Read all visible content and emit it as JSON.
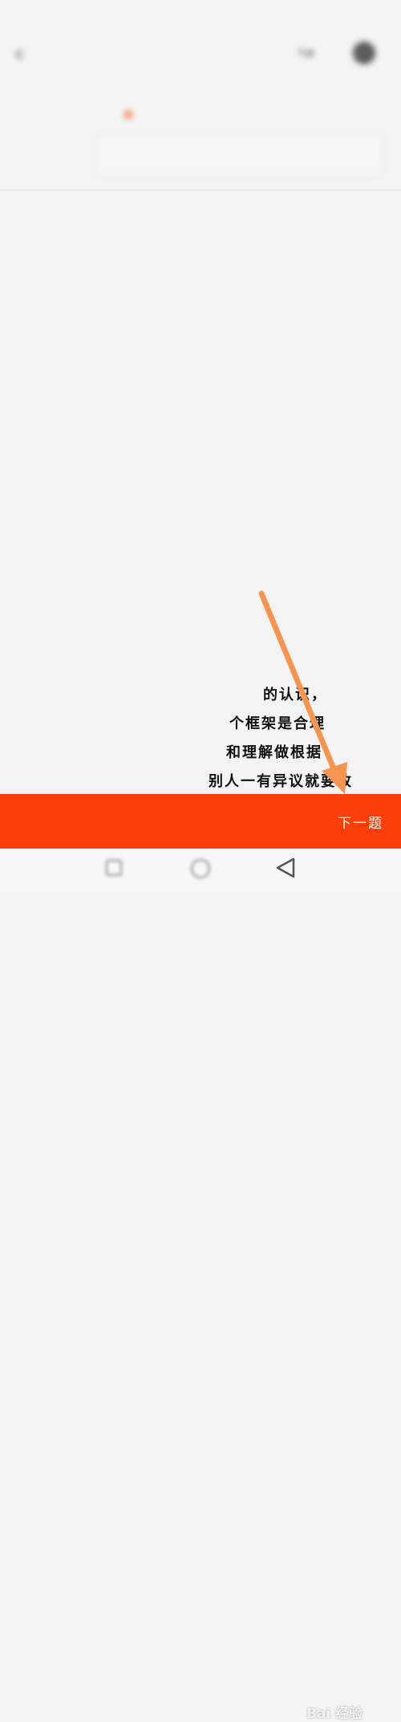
{
  "status_bar": {
    "time": "",
    "indicators": ""
  },
  "header": {
    "title": ""
  },
  "score_area": {
    "score_label": "",
    "score_value": "",
    "input_label": "",
    "input_value": ""
  },
  "article": {
    "section_heading": "",
    "paragraphs": [
      "",
      "",
      ""
    ],
    "visible_fragments": [
      "的认识，",
      "个框架是合理",
      "和理解做根据",
      "别人一有异议就要改"
    ]
  },
  "action_bar": {
    "page_counter": "",
    "next_label": "下一题"
  },
  "watermark": {
    "text": "Bai 经验"
  },
  "colors": {
    "accent": "#fc3f0a",
    "arrow": "#f49552",
    "background": "#f4f4f4"
  },
  "icons": [
    "back-icon",
    "share-icon",
    "more-icon",
    "recents-icon",
    "home-icon",
    "back-nav-icon",
    "annotation-arrow"
  ]
}
